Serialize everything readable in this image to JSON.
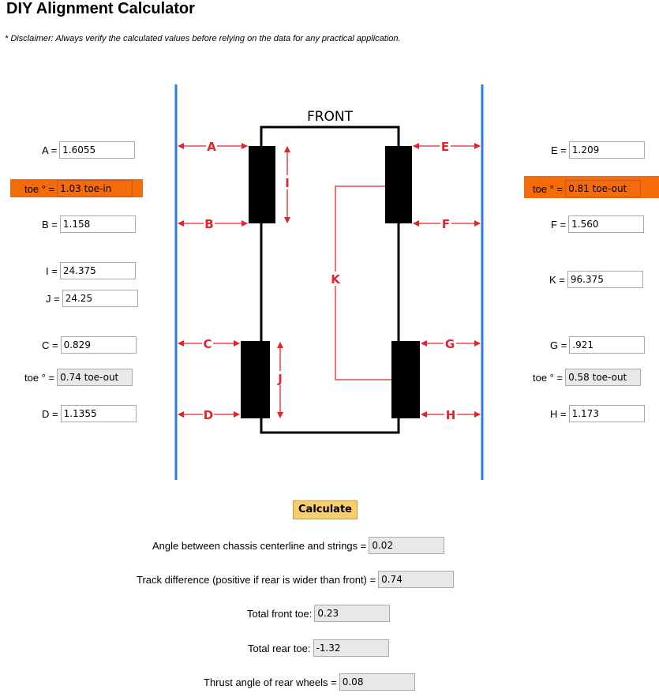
{
  "page": {
    "title": "DIY Alignment Calculator",
    "disclaimer": "* Disclaimer: Always verify the calculated values before relying on the data for any practical application."
  },
  "diagram": {
    "front_label": "FRONT",
    "labels": {
      "A": "A",
      "B": "B",
      "C": "C",
      "D": "D",
      "E": "E",
      "F": "F",
      "G": "G",
      "H": "H",
      "I": "I",
      "J": "J",
      "K": "K"
    },
    "colors": {
      "string_line": "#2a7de1",
      "dimension": "#e2242d",
      "wheel": "#000000",
      "chassis": "#000000",
      "highlight": "#f56a09"
    }
  },
  "inputs": {
    "A": {
      "label": "A =",
      "value": "1.6055"
    },
    "toe_front_left": {
      "label": "toe ° =",
      "value": "1.03 toe-in"
    },
    "B": {
      "label": "B =",
      "value": "1.158"
    },
    "I": {
      "label": "I =",
      "value": "24.375"
    },
    "J": {
      "label": "J =",
      "value": "24.25"
    },
    "C": {
      "label": "C =",
      "value": "0.829"
    },
    "toe_rear_left": {
      "label": "toe ° =",
      "value": "0.74 toe-out"
    },
    "D": {
      "label": "D =",
      "value": "1.1355"
    },
    "E": {
      "label": "E =",
      "value": "1.209"
    },
    "toe_front_right": {
      "label": "toe ° =",
      "value": "0.81 toe-out"
    },
    "F": {
      "label": "F =",
      "value": "1.560"
    },
    "K": {
      "label": "K =",
      "value": "96.375"
    },
    "G": {
      "label": "G =",
      "value": ".921"
    },
    "toe_rear_right": {
      "label": "toe ° =",
      "value": "0.58 toe-out"
    },
    "H": {
      "label": "H =",
      "value": "1.173"
    }
  },
  "calculate_label": "Calculate",
  "results": {
    "angle": {
      "label": "Angle between chassis centerline and strings =",
      "value": "0.02"
    },
    "track": {
      "label": "Track difference (positive if rear is wider than front) =",
      "value": "0.74"
    },
    "front_toe": {
      "label": "Total front toe:",
      "value": "0.23"
    },
    "rear_toe": {
      "label": "Total rear toe:",
      "value": "-1.32"
    },
    "thrust": {
      "label": "Thrust angle of rear wheels =",
      "value": "0.08"
    }
  }
}
